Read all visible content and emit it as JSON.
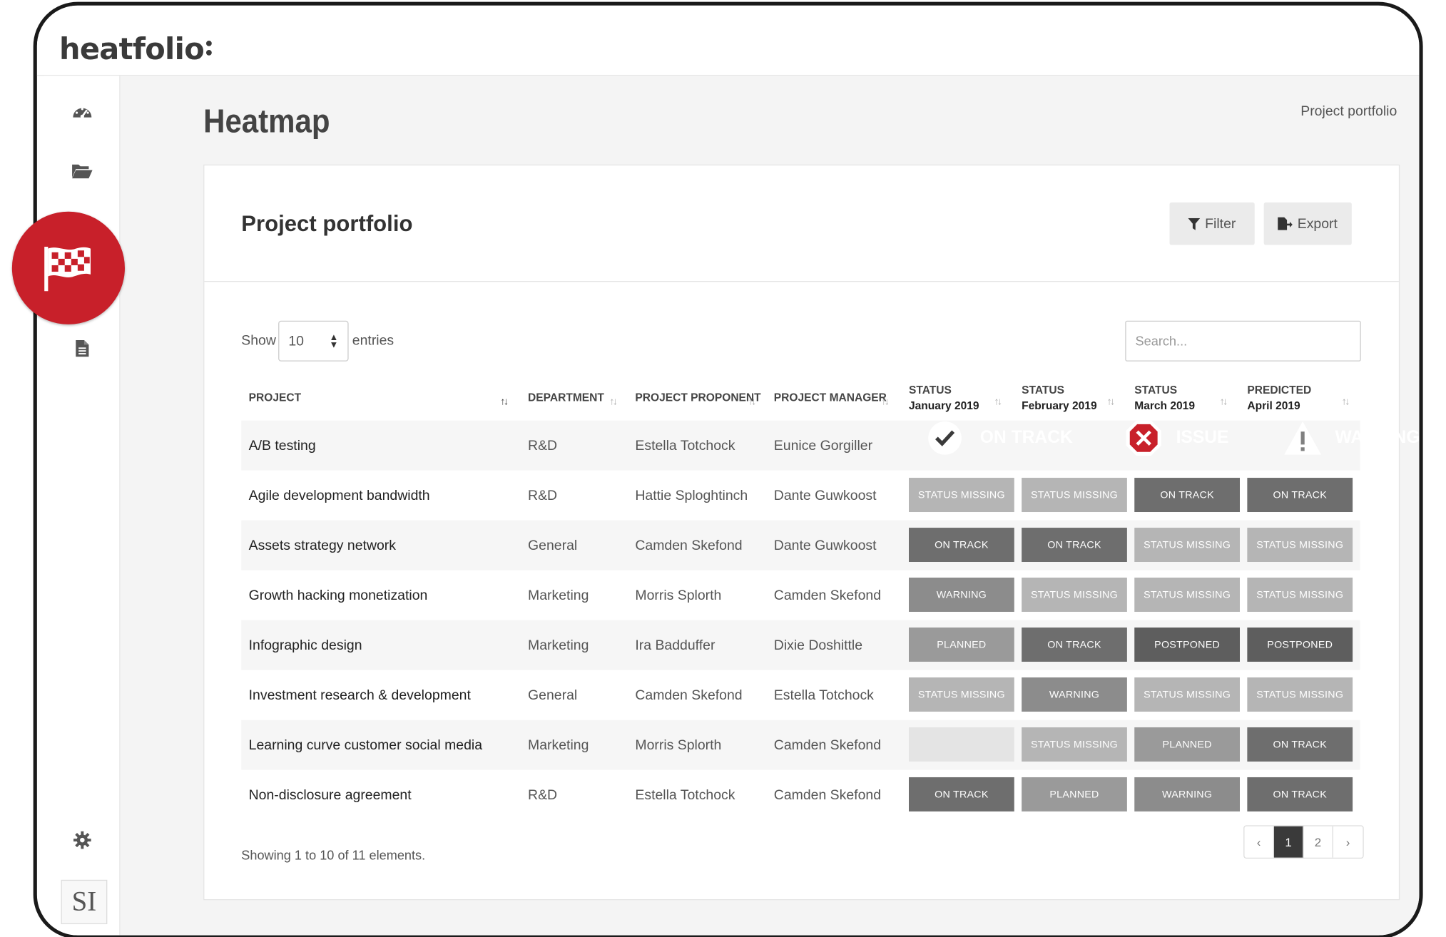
{
  "app": {
    "logo": "heatfolio",
    "page_title": "Heatmap",
    "breadcrumb": "Project portfolio"
  },
  "sidebar": {
    "items": [
      {
        "icon": "dashboard-gauge-icon"
      },
      {
        "icon": "open-folder-icon"
      },
      {
        "icon": "checkered-flag-icon",
        "active": true
      },
      {
        "icon": "document-icon"
      }
    ],
    "settings_icon": "gear-icon",
    "avatar_initials": "SI"
  },
  "card": {
    "title": "Project portfolio",
    "filter_label": "Filter",
    "export_label": "Export"
  },
  "table_controls": {
    "show_label": "Show",
    "page_size": "10",
    "entries_label": "entries",
    "search_placeholder": "Search..."
  },
  "columns": [
    {
      "label": "PROJECT",
      "sub": ""
    },
    {
      "label": "DEPARTMENT",
      "sub": ""
    },
    {
      "label": "PROJECT PROPONENT",
      "sub": ""
    },
    {
      "label": "PROJECT MANAGER",
      "sub": ""
    },
    {
      "label": "STATUS",
      "sub": "January 2019"
    },
    {
      "label": "STATUS",
      "sub": "February 2019"
    },
    {
      "label": "STATUS",
      "sub": "March 2019"
    },
    {
      "label": "PREDICTED",
      "sub": "April 2019"
    }
  ],
  "status_colors": {
    "ON TRACK": "#6e6e6e",
    "STATUS MISSING": "#b5b5b5",
    "WARNING": "#8c8c8c",
    "PLANNED": "#9a9a9a",
    "POSTPONED": "#5e5e5e",
    "EMPTY": "#e4e4e4"
  },
  "rows": [
    {
      "project": "A/B testing",
      "department": "R&D",
      "proponent": "Estella Totchock",
      "manager": "Eunice Gorgiller",
      "statuses": [
        "",
        "",
        "",
        ""
      ]
    },
    {
      "project": "Agile development bandwidth",
      "department": "R&D",
      "proponent": "Hattie Sploghtinch",
      "manager": "Dante Guwkoost",
      "statuses": [
        "STATUS MISSING",
        "STATUS MISSING",
        "ON TRACK",
        "ON TRACK"
      ]
    },
    {
      "project": "Assets strategy network",
      "department": "General",
      "proponent": "Camden Skefond",
      "manager": "Dante Guwkoost",
      "statuses": [
        "ON TRACK",
        "ON TRACK",
        "STATUS MISSING",
        "STATUS MISSING"
      ]
    },
    {
      "project": "Growth hacking monetization",
      "department": "Marketing",
      "proponent": "Morris Splorth",
      "manager": "Camden Skefond",
      "statuses": [
        "WARNING",
        "STATUS MISSING",
        "STATUS MISSING",
        "STATUS MISSING"
      ]
    },
    {
      "project": "Infographic design",
      "department": "Marketing",
      "proponent": "Ira Badduffer",
      "manager": "Dixie Doshittle",
      "statuses": [
        "PLANNED",
        "ON TRACK",
        "POSTPONED",
        "POSTPONED"
      ]
    },
    {
      "project": "Investment research & development",
      "department": "General",
      "proponent": "Camden Skefond",
      "manager": "Estella Totchock",
      "statuses": [
        "STATUS MISSING",
        "WARNING",
        "STATUS MISSING",
        "STATUS MISSING"
      ]
    },
    {
      "project": "Learning curve customer social media",
      "department": "Marketing",
      "proponent": "Morris Splorth",
      "manager": "Camden Skefond",
      "statuses": [
        "",
        "STATUS MISSING",
        "PLANNED",
        "ON TRACK"
      ]
    },
    {
      "project": "Non-disclosure agreement",
      "department": "R&D",
      "proponent": "Estella Totchock",
      "manager": "Camden Skefond",
      "statuses": [
        "ON TRACK",
        "PLANNED",
        "WARNING",
        "ON TRACK"
      ]
    }
  ],
  "footer": {
    "summary": "Showing 1 to 10 of 11 elements."
  },
  "pagination": {
    "prev": "‹",
    "pages": [
      "1",
      "2"
    ],
    "current": "1",
    "next": "›"
  },
  "legend": [
    {
      "label": "ON TRACK",
      "icon": "check-circle-icon",
      "color": "#3a3a3a"
    },
    {
      "label": "ISSUE",
      "icon": "x-octagon-icon",
      "color": "#c8202a"
    },
    {
      "label": "WARNING",
      "icon": "warning-triangle-icon",
      "color": "#808080"
    }
  ]
}
